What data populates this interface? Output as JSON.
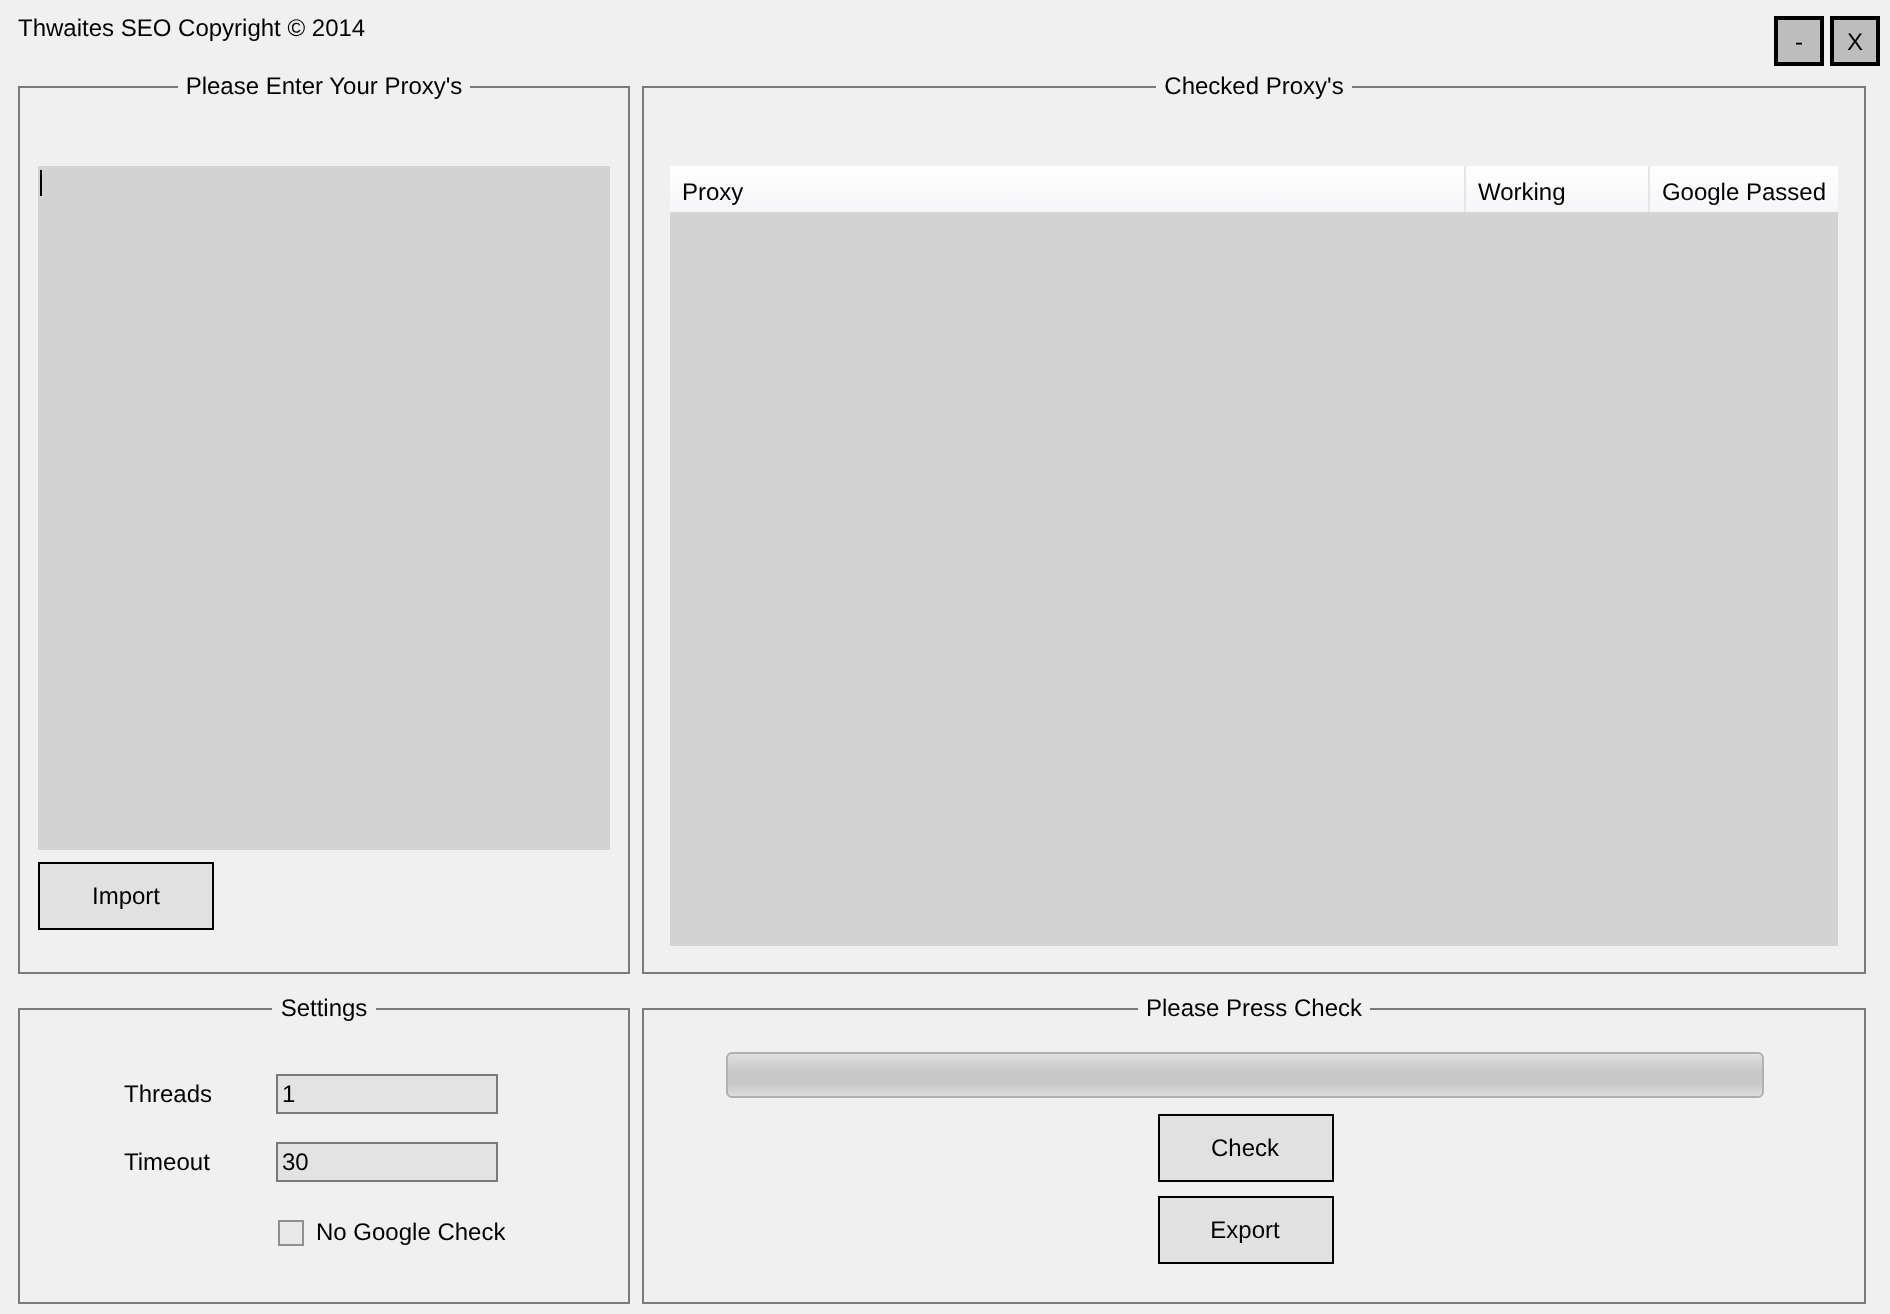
{
  "window": {
    "title": "Thwaites SEO Copyright © 2014",
    "buttons": [
      "-",
      "X"
    ]
  },
  "proxy_input": {
    "title": "Please Enter Your Proxy's",
    "import_button": "Import"
  },
  "checked_proxies": {
    "title": "Checked Proxy's",
    "columns": [
      "Proxy",
      "Working",
      "Google Passed"
    ]
  },
  "settings": {
    "title": "Settings",
    "fields": [
      {
        "label": "Threads",
        "value": "1"
      },
      {
        "label": "Timeout",
        "value": "30"
      }
    ],
    "no_google_check": {
      "label": "No Google Check",
      "checked": false
    }
  },
  "check_panel": {
    "title": "Please Press Check",
    "progress": {
      "level": 0
    },
    "buttons": [
      "Check",
      "Export"
    ]
  }
}
